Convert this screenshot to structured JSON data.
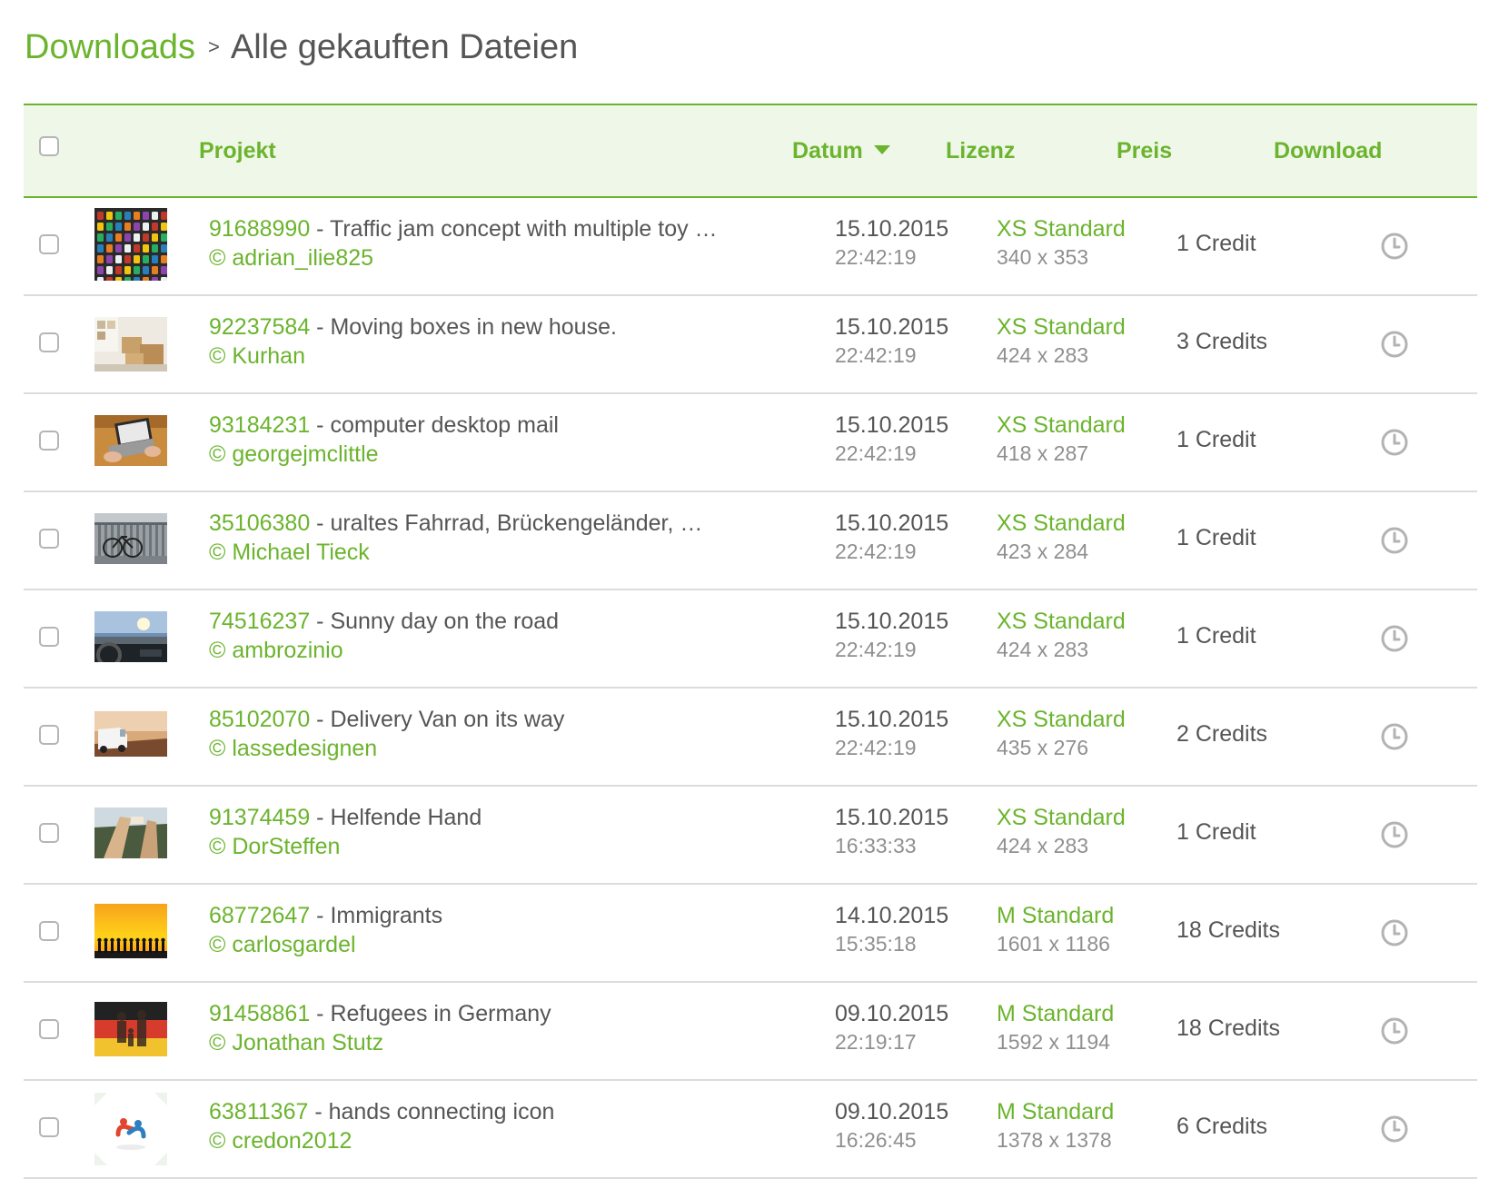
{
  "breadcrumb": {
    "root": "Downloads",
    "separator": ">",
    "current": "Alle gekauften Dateien"
  },
  "table": {
    "headers": {
      "project": "Projekt",
      "date": "Datum",
      "license": "Lizenz",
      "price": "Preis",
      "download": "Download"
    },
    "rows": [
      {
        "id": "91688990",
        "title": " - Traffic jam concept with multiple toy …",
        "author": "© adrian_ilie825",
        "date": "15.10.2015",
        "time": "22:42:19",
        "license": "XS Standard",
        "dimensions": "340 x 353",
        "price": "1 Credit",
        "thumb": "toy-cars-grid"
      },
      {
        "id": "92237584",
        "title": " - Moving boxes in new house.",
        "author": "© Kurhan",
        "date": "15.10.2015",
        "time": "22:42:19",
        "license": "XS Standard",
        "dimensions": "424 x 283",
        "price": "3 Credits",
        "thumb": "moving-boxes"
      },
      {
        "id": "93184231",
        "title": " - computer desktop mail",
        "author": "© georgejmclittle",
        "date": "15.10.2015",
        "time": "22:42:19",
        "license": "XS Standard",
        "dimensions": "418 x 287",
        "price": "1 Credit",
        "thumb": "laptop-desk"
      },
      {
        "id": "35106380",
        "title": " - uraltes Fahrrad, Brückengeländer, …",
        "author": "© Michael Tieck",
        "date": "15.10.2015",
        "time": "22:42:19",
        "license": "XS Standard",
        "dimensions": "423 x 284",
        "price": "1 Credit",
        "thumb": "bicycle-railing"
      },
      {
        "id": "74516237",
        "title": " - Sunny day on the road",
        "author": "© ambrozinio",
        "date": "15.10.2015",
        "time": "22:42:19",
        "license": "XS Standard",
        "dimensions": "424 x 283",
        "price": "1 Credit",
        "thumb": "car-dashboard"
      },
      {
        "id": "85102070",
        "title": " - Delivery Van on its way",
        "author": "© lassedesignen",
        "date": "15.10.2015",
        "time": "22:42:19",
        "license": "XS Standard",
        "dimensions": "435 x 276",
        "price": "2 Credits",
        "thumb": "delivery-van"
      },
      {
        "id": "91374459",
        "title": " - Helfende Hand",
        "author": "© DorSteffen",
        "date": "15.10.2015",
        "time": "16:33:33",
        "license": "XS Standard",
        "dimensions": "424 x 283",
        "price": "1 Credit",
        "thumb": "helping-hand"
      },
      {
        "id": "68772647",
        "title": " - Immigrants",
        "author": "© carlosgardel",
        "date": "14.10.2015",
        "time": "15:35:18",
        "license": "M Standard",
        "dimensions": "1601 x 1186",
        "price": "18 Credits",
        "thumb": "immigrants-sunset"
      },
      {
        "id": "91458861",
        "title": " - Refugees in Germany",
        "author": "© Jonathan Stutz",
        "date": "09.10.2015",
        "time": "22:19:17",
        "license": "M Standard",
        "dimensions": "1592 x 1194",
        "price": "18 Credits",
        "thumb": "refugees-flag"
      },
      {
        "id": "63811367",
        "title": " - hands connecting icon",
        "author": "© credon2012",
        "date": "09.10.2015",
        "time": "16:26:45",
        "license": "M Standard",
        "dimensions": "1378 x 1378",
        "price": "6 Credits",
        "thumb": "hands-icon"
      }
    ]
  },
  "icons": {
    "download": "clock-icon",
    "sort": "caret-down-icon"
  },
  "colors": {
    "accent": "#6bb42d",
    "header_bg": "#eff7e8",
    "text": "#555555",
    "muted": "#8f8f8f",
    "divider": "#dcdcdc",
    "icon": "#b3b3b3"
  }
}
